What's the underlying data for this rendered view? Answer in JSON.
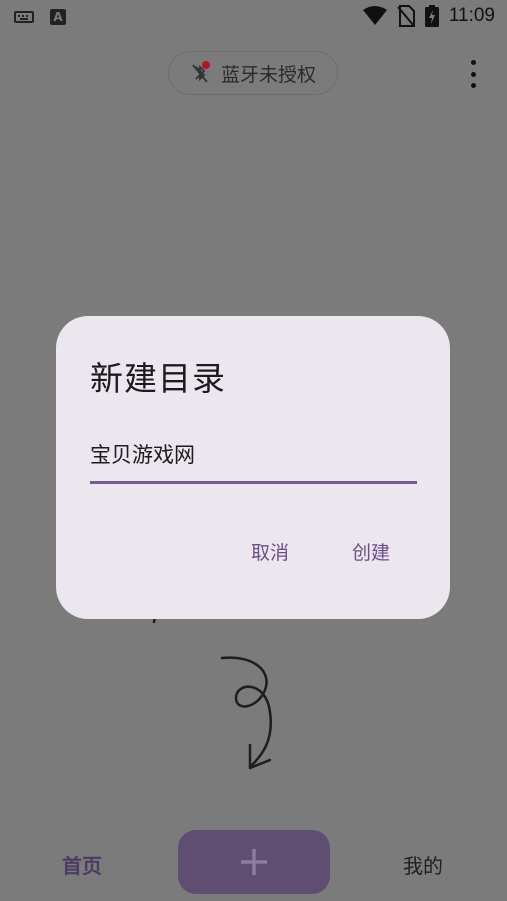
{
  "status_bar": {
    "time": "11:09"
  },
  "header": {
    "bluetooth_chip_label": "蓝牙未授权"
  },
  "dialog": {
    "title": "新建目录",
    "input_value": "宝贝游戏网",
    "cancel_label": "取消",
    "create_label": "创建"
  },
  "bottom_nav": {
    "home_label": "首页",
    "mine_label": "我的",
    "add_button_icon": "plus-icon"
  },
  "colors": {
    "scrim": "#7b7b7b",
    "dialog_bg": "#ece6ef",
    "accent": "#6b4f8a",
    "add_button": "#5f4d72"
  }
}
